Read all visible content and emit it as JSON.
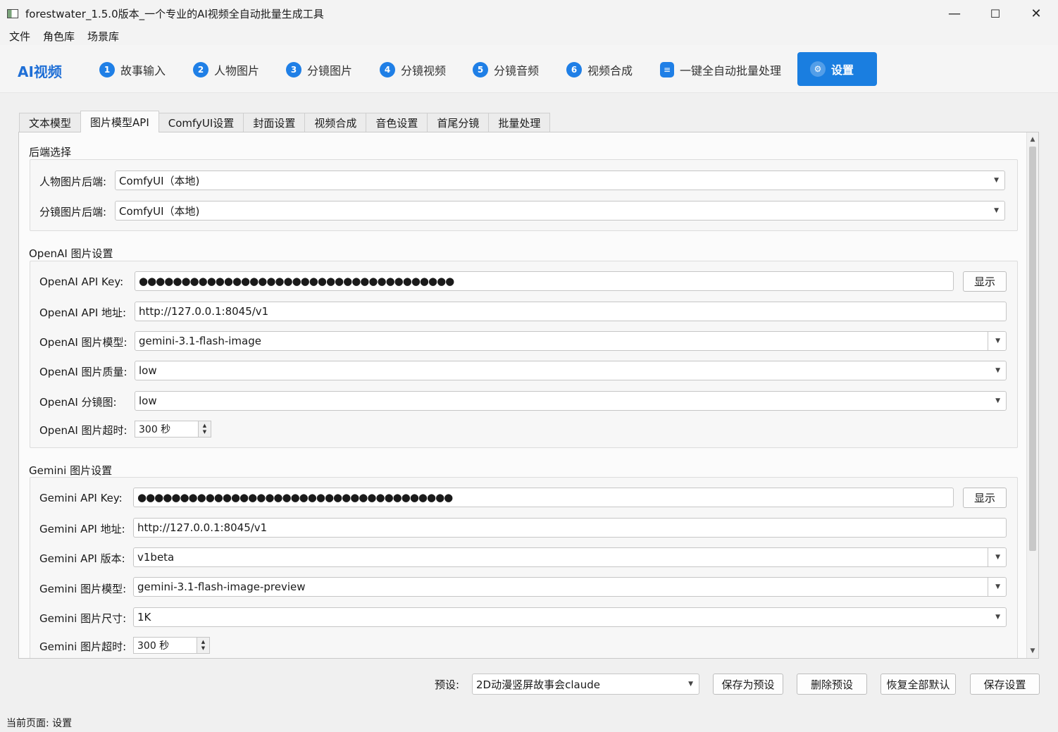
{
  "window": {
    "title": "forestwater_1.5.0版本_一个专业的AI视频全自动批量生成工具",
    "controls": {
      "minimize": "—",
      "maximize": "☐",
      "close": "✕"
    }
  },
  "menu": [
    "文件",
    "角色库",
    "场景库"
  ],
  "nav": {
    "brand": "AI视频",
    "steps": [
      {
        "num": "1",
        "label": "故事输入"
      },
      {
        "num": "2",
        "label": "人物图片"
      },
      {
        "num": "3",
        "label": "分镜图片"
      },
      {
        "num": "4",
        "label": "分镜视频"
      },
      {
        "num": "5",
        "label": "分镜音频"
      },
      {
        "num": "6",
        "label": "视频合成"
      }
    ],
    "batch_label": "一键全自动批量处理",
    "settings_label": "设置"
  },
  "tabs": [
    "文本模型",
    "图片模型API",
    "ComfyUI设置",
    "封面设置",
    "视频合成",
    "音色设置",
    "首尾分镜",
    "批量处理"
  ],
  "backend": {
    "title": "后端选择",
    "character_label": "人物图片后端:",
    "character_value": "ComfyUI（本地)",
    "storyboard_label": "分镜图片后端:",
    "storyboard_value": "ComfyUI（本地)"
  },
  "openai": {
    "title": "OpenAI 图片设置",
    "key_label": "OpenAI API Key:",
    "key_value": "●●●●●●●●●●●●●●●●●●●●●●●●●●●●●●●●●●●●●",
    "show_label": "显示",
    "url_label": "OpenAI API 地址:",
    "url_value": "http://127.0.0.1:8045/v1",
    "model_label": "OpenAI 图片模型:",
    "model_value": "gemini-3.1-flash-image",
    "quality_label": "OpenAI 图片质量:",
    "quality_value": "low",
    "storyboard_label": "OpenAI 分镜图:",
    "storyboard_value": "low",
    "timeout_label": "OpenAI 图片超时:",
    "timeout_value": "300 秒"
  },
  "gemini": {
    "title": "Gemini 图片设置",
    "key_label": "Gemini API Key:",
    "key_value": "●●●●●●●●●●●●●●●●●●●●●●●●●●●●●●●●●●●●●",
    "show_label": "显示",
    "url_label": "Gemini API 地址:",
    "url_value": "http://127.0.0.1:8045/v1",
    "version_label": "Gemini API 版本:",
    "version_value": "v1beta",
    "model_label": "Gemini 图片模型:",
    "model_value": "gemini-3.1-flash-image-preview",
    "size_label": "Gemini 图片尺寸:",
    "size_value": "1K",
    "timeout_label": "Gemini 图片超时:",
    "timeout_value": "300 秒"
  },
  "bottom": {
    "preset_label": "预设:",
    "preset_value": "2D动漫竖屏故事会claude",
    "save_preset": "保存为预设",
    "delete_preset": "删除预设",
    "restore_defaults": "恢复全部默认",
    "save_settings": "保存设置"
  },
  "status": "当前页面: 设置",
  "colors": {
    "accent": "#1a7ee0",
    "brand": "#1f6fd6"
  }
}
